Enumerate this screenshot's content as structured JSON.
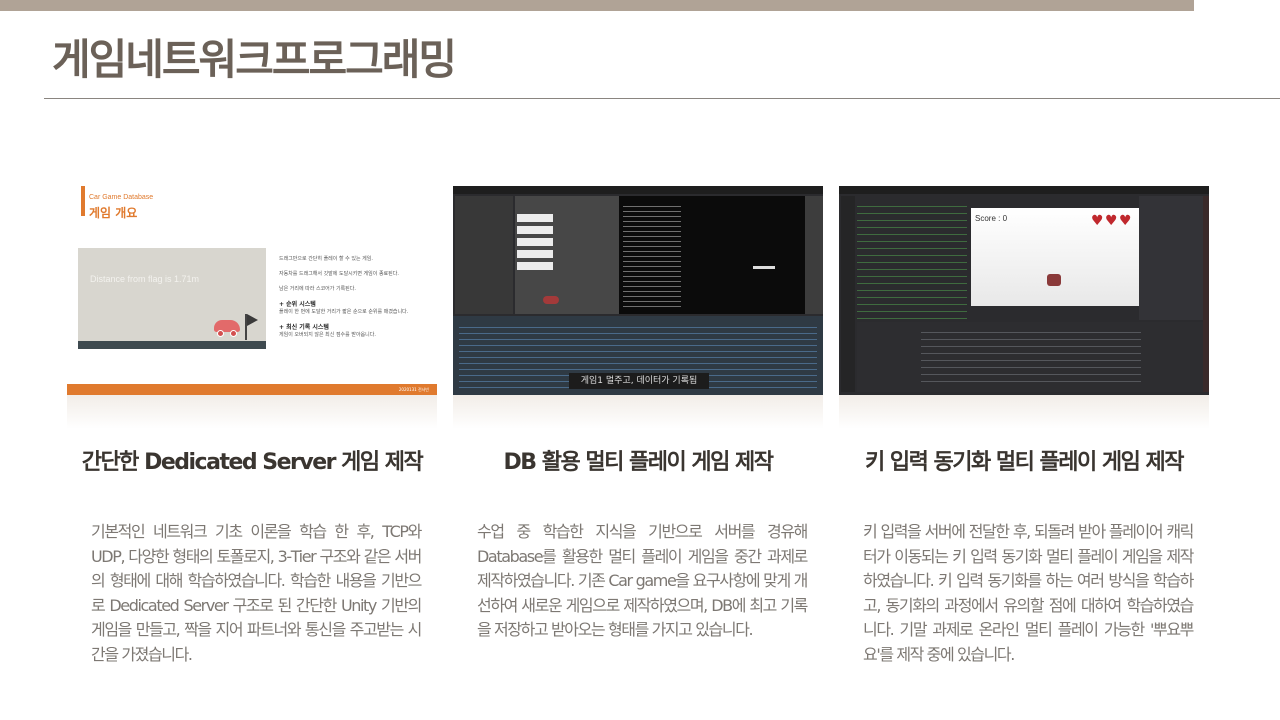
{
  "header": {
    "title": "게임네트워크프로그래밍"
  },
  "colors": {
    "top_bar": "#b0a396",
    "title": "#6b6158",
    "accent_orange": "#e07a2e"
  },
  "cards": [
    {
      "title": "간단한 Dedicated Server 게임 제작",
      "body": "기본적인 네트워크 기초 이론을 학습 한 후, TCP와 UDP, 다양한 형태의 토폴로지, 3-Tier 구조와 같은 서버의 형태에 대해 학습하였습니다. 학습한 내용을 기반으로 Dedicated Server 구조로 된 간단한 Unity 기반의 게임을 만들고, 짝을 지어 파트너와 통신을 주고받는 시간을 가졌습니다.",
      "thumbnail": {
        "subtitle": "Car Game Database",
        "heading": "게임 개요",
        "scene_text": "Distance from flag is 1.71m",
        "notes": [
          "드래그만으로 간단히 플레이 할 수 있는 게임.",
          "자동차를 드래그해서 깃발에 도달시키면 게임이 종료된다.",
          "남은 거리에 따라 스코어가 기록된다."
        ],
        "features": [
          {
            "title": "+ 순위 시스템",
            "desc": "플레이 한 번에 도달한 거리가 짧은 순으로 순위를 매겼습니다."
          },
          {
            "title": "+ 최신 기록 시스템",
            "desc": "게임이 오버되지 않은 최신 점수를 받아옵니다."
          }
        ],
        "footer": "2020131 전사빈"
      }
    },
    {
      "title": "DB 활용 멀티 플레이 게임 제작",
      "body": "수업 중 학습한 지식을 기반으로 서버를 경유해 Database를 활용한 멀티 플레이 게임을 중간 과제로 제작하였습니다. 기존 Car game을 요구사항에 맞게 개선하여 새로운 게임으로 제작하였으며, DB에 최고 기록을 저장하고 받아오는 형태를 가지고 있습니다.",
      "thumbnail": {
        "caption": "게임1 멀주고, 데이터가 기록됨"
      }
    },
    {
      "title": "키 입력 동기화 멀티 플레이 게임 제작",
      "body": "키 입력을 서버에 전달한 후, 되돌려 받아 플레이어 캐릭터가 이동되는 키 입력 동기화 멀티 플레이 게임을 제작하였습니다. 키 입력 동기화를 하는 여러 방식을 학습하고, 동기화의 과정에서 유의할 점에 대하여 학습하였습니다. 기말 과제로 온라인 멀티 플레이 가능한 '뿌요뿌요'를 제작 중에 있습니다.",
      "thumbnail": {
        "score_text": "Score : 0",
        "lives": 3
      }
    }
  ]
}
